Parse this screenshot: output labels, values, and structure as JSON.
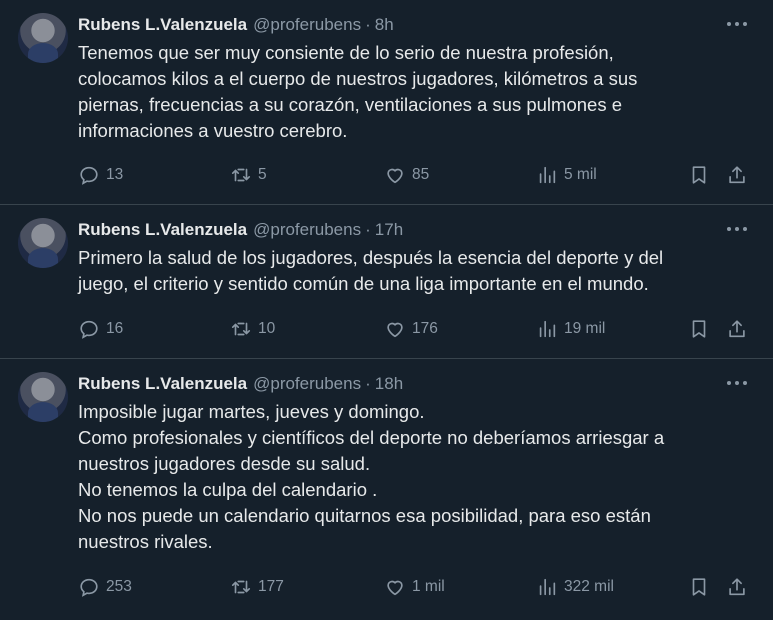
{
  "tweets": [
    {
      "author": "Rubens L.Valenzuela",
      "handle": "@proferubens",
      "sep": "·",
      "time": "8h",
      "lines": [
        "Tenemos que ser muy consiente de lo serio de nuestra profesión,",
        "colocamos kilos a el cuerpo de nuestros jugadores, kilómetros a sus",
        "piernas, frecuencias a su corazón, ventilaciones a sus pulmones e",
        "informaciones a vuestro cerebro."
      ],
      "replies": "13",
      "retweets": "5",
      "likes": "85",
      "views": "5 mil"
    },
    {
      "author": "Rubens L.Valenzuela",
      "handle": "@proferubens",
      "sep": "·",
      "time": "17h",
      "lines": [
        "Primero la salud de los jugadores, después la esencia del deporte y del",
        "juego, el criterio y sentido común de una liga importante en el mundo."
      ],
      "replies": "16",
      "retweets": "10",
      "likes": "176",
      "views": "19 mil"
    },
    {
      "author": "Rubens L.Valenzuela",
      "handle": "@proferubens",
      "sep": "·",
      "time": "18h",
      "lines": [
        "Imposible jugar martes, jueves y domingo.",
        "Como profesionales y científicos del deporte no deberíamos arriesgar a",
        "nuestros jugadores desde su salud.",
        "No tenemos la culpa del calendario .",
        "No nos puede un calendario quitarnos esa posibilidad, para eso están",
        "nuestros rivales."
      ],
      "replies": "253",
      "retweets": "177",
      "likes": "1 mil",
      "views": "322 mil"
    }
  ]
}
